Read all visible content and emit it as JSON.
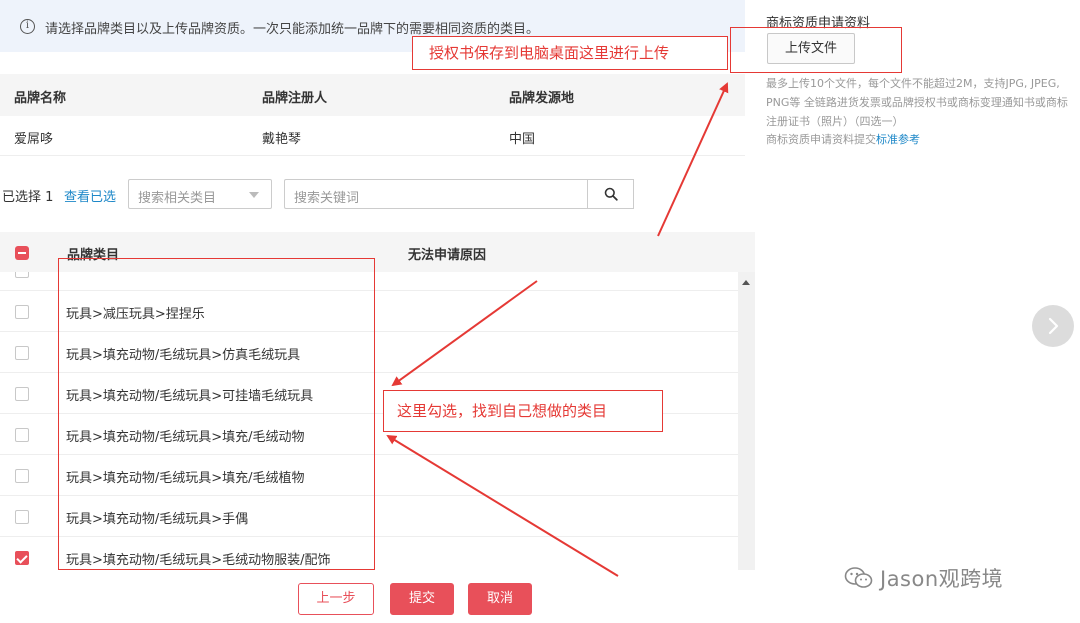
{
  "info": {
    "icon": "info-icon",
    "text": "请选择品牌类目以及上传品牌资质。一次只能添加统一品牌下的需要相同资质的类目。"
  },
  "brand_table": {
    "headers": [
      "品牌名称",
      "品牌注册人",
      "品牌发源地"
    ],
    "row": [
      "爱屌哆",
      "戴艳琴",
      "中国"
    ]
  },
  "filter": {
    "selected_count": "已选择 1",
    "view_selected": "查看已选",
    "category_placeholder": "搜索相关类目",
    "keyword_placeholder": "搜索关键词"
  },
  "category_table": {
    "col_category": "品牌类目",
    "col_reason": "无法申请原因",
    "rows": [
      {
        "label": "玩具>减压玩具>捏捏乐",
        "checked": false
      },
      {
        "label": "玩具>填充动物/毛绒玩具>仿真毛绒玩具",
        "checked": false
      },
      {
        "label": "玩具>填充动物/毛绒玩具>可挂墙毛绒玩具",
        "checked": false
      },
      {
        "label": "玩具>填充动物/毛绒玩具>填充/毛绒动物",
        "checked": false
      },
      {
        "label": "玩具>填充动物/毛绒玩具>填充/毛绒植物",
        "checked": false
      },
      {
        "label": "玩具>填充动物/毛绒玩具>手偶",
        "checked": false
      },
      {
        "label": "玩具>填充动物/毛绒玩具>毛绒动物服装/配饰",
        "checked": true
      }
    ]
  },
  "buttons": {
    "prev": "上一步",
    "submit": "提交",
    "cancel": "取消"
  },
  "right_panel": {
    "title": "商标资质申请资料",
    "upload_label": "上传文件",
    "description": "最多上传10个文件，每个文件不能超过2M，支持JPG, JPEG, PNG等 全链路进货发票或品牌授权书或商标变理通知书或商标注册证书（照片）（四选一）",
    "note_prefix": "商标资质申请资料提交",
    "note_link": "标准参考"
  },
  "annotations": {
    "upload_hint": "授权书保存到电脑桌面这里进行上传",
    "select_hint": "这里勾选，找到自己想做的类目"
  },
  "watermark": "Jason观跨境",
  "colors": {
    "accent": "#e8505a",
    "annotation": "#e53935",
    "link": "#1e88c8"
  }
}
